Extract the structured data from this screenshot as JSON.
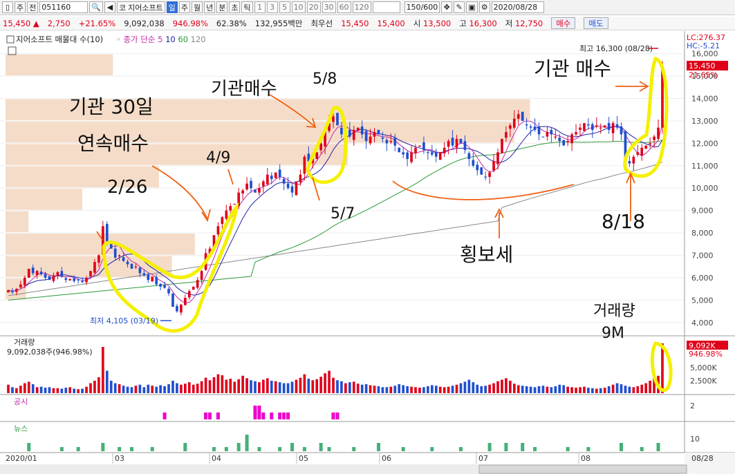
{
  "toolbar": {
    "period_type": "주",
    "market": "전",
    "code": "051160",
    "stock_name": "지어소프트",
    "stock_prefix": "코",
    "tabs": [
      "일",
      "주",
      "월",
      "년",
      "분",
      "초",
      "틱"
    ],
    "active_tab": "일",
    "intervals": [
      "1",
      "3",
      "5",
      "10",
      "20",
      "30",
      "60",
      "120"
    ],
    "count": "150",
    "count_total": "/600",
    "date": "2020/08/28"
  },
  "infobar": {
    "price": "15,450",
    "change": "2,750",
    "change_pct": "+21.65%",
    "volume": "9,092,038",
    "volume_pct": "946.98%",
    "ratio": "62.38%",
    "amount": "132,955백만",
    "best_label": "최우선",
    "best_ask": "15,450",
    "best_bid": "15,400",
    "open_label": "시",
    "open": "13,500",
    "high_label": "고",
    "high": "16,300",
    "low_label": "저",
    "low": "12,750",
    "buy_button": "매수",
    "sell_button": "매도"
  },
  "legend": {
    "title": "지어소프트 매물대 수(10)",
    "ma_label": "종가 단순",
    "ma_periods": [
      "5",
      "10",
      "60",
      "120"
    ],
    "lc": "LC:276.37",
    "hc": "HC:-5.21",
    "volume_title": "거래량",
    "volume_value": "9,092,038주(946.98%)",
    "disclosure_title": "공시",
    "news_title": "뉴스"
  },
  "colors": {
    "up": "#e0001a",
    "down": "#1f4fd0",
    "ma5": "#c02aa8",
    "ma10": "#2020a8",
    "ma60": "#2a9a3a",
    "ma120": "#888888",
    "highlight": "#f4f000",
    "arrow": "#f06010",
    "profile": "#f5dcc8"
  },
  "chart_data": {
    "type": "candlestick",
    "y_ticks": [
      4000,
      5000,
      6000,
      7000,
      8000,
      9000,
      10000,
      11000,
      12000,
      13000,
      14000,
      15000,
      16000
    ],
    "y_tick_labels": [
      "4,000",
      "5,000",
      "6,000",
      "7,000",
      "8,000",
      "9,000",
      "10,000",
      "11,000",
      "12,000",
      "13,000",
      "14,000",
      "15,000",
      "16,000"
    ],
    "ylim": [
      3500,
      16700
    ],
    "month_labels": [
      "2020/01",
      "03",
      "04",
      "05",
      "06",
      "07",
      "08",
      "08/28"
    ],
    "last_price_label": "15,450",
    "last_change_label": "21.65%",
    "high_label": "최고 16,300 (08/28)",
    "low_label": "최저 4,105 (03/19)",
    "volume_last_label": "9,092K",
    "volume_last_pct": "946.98%",
    "volume_ticks": [
      "5,000K",
      "2,500K"
    ],
    "disclosure_tick": "2",
    "news_tick": "10",
    "profile_levels": [
      {
        "price": 15000,
        "size": 0.42
      },
      {
        "price": 13000,
        "size": 1.0
      },
      {
        "price": 12000,
        "size": 0.97
      },
      {
        "price": 11000,
        "size": 0.88
      },
      {
        "price": 10000,
        "size": 0.6
      },
      {
        "price": 9000,
        "size": 0.3
      },
      {
        "price": 8000,
        "size": 0.09
      },
      {
        "price": 7000,
        "size": 0.74
      },
      {
        "price": 6000,
        "size": 0.65
      },
      {
        "price": 5000,
        "size": 0.08
      }
    ],
    "close": [
      5450,
      5350,
      5500,
      5700,
      6000,
      6400,
      6200,
      6300,
      6150,
      6000,
      5900,
      6100,
      6250,
      6050,
      5900,
      5950,
      5850,
      5900,
      5800,
      6000,
      6300,
      6700,
      7000,
      8300,
      7600,
      7300,
      6900,
      7000,
      6750,
      6600,
      6400,
      6500,
      6200,
      6100,
      5900,
      6050,
      5700,
      5600,
      5550,
      5300,
      4700,
      4500,
      4800,
      5100,
      5400,
      5600,
      5900,
      6300,
      7100,
      7300,
      7900,
      8300,
      8700,
      9000,
      9200,
      9300,
      9800,
      9900,
      10200,
      10000,
      9800,
      10000,
      10300,
      10600,
      10400,
      10700,
      10500,
      10200,
      10000,
      9800,
      10300,
      10600,
      11400,
      11200,
      11300,
      11600,
      12000,
      12600,
      12900,
      13200,
      12800,
      12400,
      12500,
      12300,
      12600,
      12700,
      12400,
      12100,
      12300,
      12500,
      12400,
      12200,
      12000,
      12100,
      11900,
      11600,
      11500,
      11300,
      11600,
      11800,
      11900,
      11700,
      11600,
      11500,
      11400,
      11600,
      11800,
      12100,
      11900,
      12200,
      12000,
      11700,
      11300,
      11000,
      10800,
      10600,
      10500,
      10700,
      11200,
      11600,
      12200,
      12500,
      12800,
      13100,
      13300,
      13000,
      12800,
      12700,
      12600,
      12400,
      12300,
      12500,
      12400,
      12300,
      12100,
      11900,
      12100,
      12400,
      12500,
      12700,
      12900,
      12800,
      12600,
      12800,
      12700,
      12800,
      12600,
      12900,
      12700,
      12400,
      11300,
      11100,
      11400,
      11600,
      11800,
      11900,
      12000,
      12300,
      12700,
      15450
    ],
    "volume": [
      0.17,
      0.12,
      0.1,
      0.15,
      0.2,
      0.23,
      0.18,
      0.12,
      0.13,
      0.11,
      0.12,
      0.1,
      0.1,
      0.09,
      0.11,
      0.12,
      0.09,
      0.08,
      0.09,
      0.13,
      0.2,
      0.25,
      0.32,
      0.93,
      0.45,
      0.25,
      0.2,
      0.18,
      0.15,
      0.13,
      0.12,
      0.15,
      0.17,
      0.12,
      0.17,
      0.15,
      0.13,
      0.16,
      0.14,
      0.18,
      0.25,
      0.2,
      0.17,
      0.19,
      0.22,
      0.17,
      0.19,
      0.24,
      0.31,
      0.26,
      0.32,
      0.38,
      0.36,
      0.27,
      0.29,
      0.23,
      0.28,
      0.35,
      0.3,
      0.26,
      0.24,
      0.22,
      0.27,
      0.3,
      0.25,
      0.24,
      0.22,
      0.2,
      0.2,
      0.23,
      0.27,
      0.31,
      0.38,
      0.29,
      0.26,
      0.28,
      0.33,
      0.4,
      0.45,
      0.31,
      0.26,
      0.24,
      0.2,
      0.22,
      0.23,
      0.19,
      0.17,
      0.18,
      0.16,
      0.15,
      0.14,
      0.12,
      0.12,
      0.13,
      0.15,
      0.18,
      0.16,
      0.14,
      0.13,
      0.12,
      0.11,
      0.12,
      0.14,
      0.16,
      0.15,
      0.13,
      0.12,
      0.13,
      0.15,
      0.17,
      0.2,
      0.23,
      0.27,
      0.22,
      0.17,
      0.14,
      0.15,
      0.17,
      0.2,
      0.24,
      0.27,
      0.3,
      0.25,
      0.19,
      0.16,
      0.15,
      0.14,
      0.13,
      0.12,
      0.14,
      0.15,
      0.13,
      0.12,
      0.14,
      0.17,
      0.16,
      0.13,
      0.12,
      0.11,
      0.12,
      0.13,
      0.11,
      0.1,
      0.09,
      0.1,
      0.11,
      0.14,
      0.17,
      0.2,
      0.18,
      0.15,
      0.13,
      0.12,
      0.14,
      0.17,
      0.2,
      0.25,
      0.3,
      0.35,
      1.0
    ],
    "disclosure_days": [
      38,
      48,
      49,
      51,
      60,
      61,
      62,
      64,
      66,
      67,
      68,
      79,
      80
    ],
    "news": [
      [
        5,
        2
      ],
      [
        13,
        1
      ],
      [
        17,
        1
      ],
      [
        23,
        2
      ],
      [
        27,
        1
      ],
      [
        30,
        1
      ],
      [
        35,
        1
      ],
      [
        43,
        2
      ],
      [
        50,
        1
      ],
      [
        53,
        1
      ],
      [
        56,
        2
      ],
      [
        58,
        4
      ],
      [
        61,
        1
      ],
      [
        66,
        1
      ],
      [
        69,
        2
      ],
      [
        72,
        1
      ],
      [
        76,
        2
      ],
      [
        78,
        1
      ],
      [
        84,
        1
      ],
      [
        90,
        2
      ],
      [
        96,
        1
      ],
      [
        103,
        1
      ],
      [
        110,
        1
      ],
      [
        117,
        2
      ],
      [
        121,
        2
      ],
      [
        125,
        2
      ],
      [
        128,
        1
      ],
      [
        136,
        1
      ],
      [
        141,
        1
      ],
      [
        149,
        2
      ],
      [
        154,
        1
      ],
      [
        158,
        2
      ]
    ]
  },
  "annotations": {
    "a1": "기관 30일",
    "a2": "연속매수",
    "a3": "2/26",
    "a4": "4/9",
    "a5": "5/7",
    "a6": "5/8",
    "a7": "기관매수",
    "a8": "횡보세",
    "a9": "기관 매수",
    "a10": "8/18",
    "a11": "거래량",
    "a12": "9M"
  }
}
